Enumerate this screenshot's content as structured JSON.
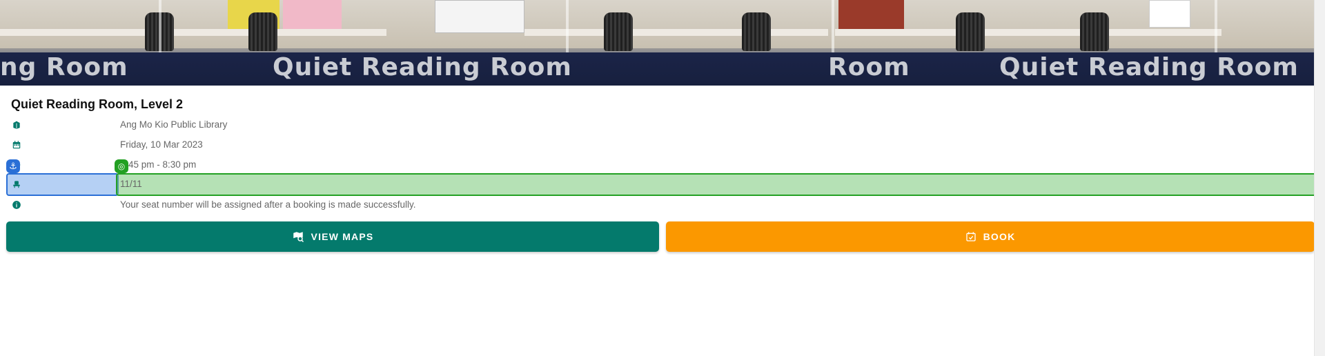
{
  "hero": {
    "banner_texts": [
      "ng Room",
      "Quiet Reading Room",
      "Room",
      "Quiet Reading Room"
    ]
  },
  "room": {
    "title": "Quiet Reading Room, Level 2",
    "library": "Ang Mo Kio Public Library",
    "date": "Friday, 10 Mar 2023",
    "time": "45 pm - 8:30 pm",
    "seats": "11/11",
    "seat_note": "Your seat number will be assigned after a booking is made successfully."
  },
  "icons": {
    "library": "book-open-icon",
    "date": "calendar-icon",
    "time": "clock-icon",
    "seats": "seat-icon",
    "info": "info-icon",
    "maps": "map-search-icon",
    "book": "calendar-check-icon"
  },
  "actions": {
    "view_maps": "VIEW MAPS",
    "book": "BOOK"
  },
  "colors": {
    "primary": "#047a6c",
    "accent": "#fb9800",
    "icon": "#047a6c"
  }
}
